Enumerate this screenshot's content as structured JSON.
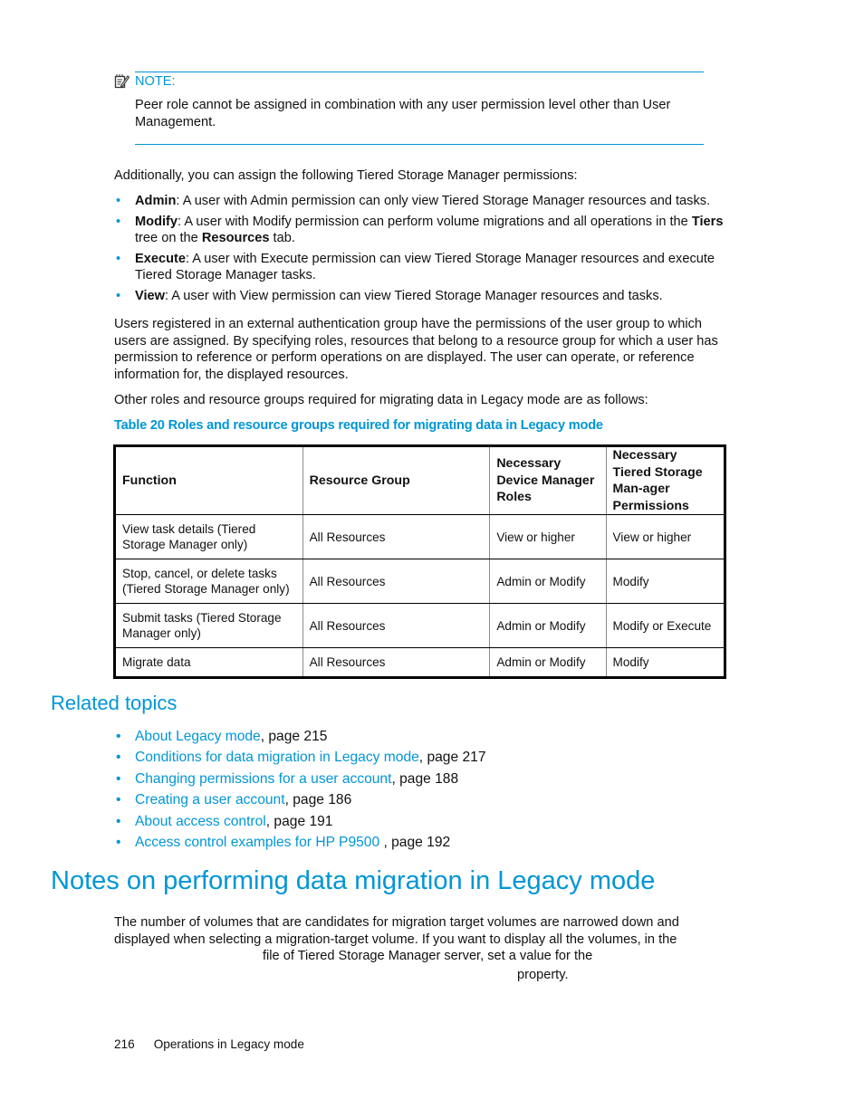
{
  "note": {
    "icon": "note-pencil-icon",
    "label": "NOTE:",
    "text": "Peer role cannot be assigned in combination with any user permission level other than User Management."
  },
  "intro": "Additionally, you can assign the following Tiered Storage Manager permissions:",
  "permissions": [
    {
      "term": "Admin",
      "parts": [
        ": A user with Admin permission can only view Tiered Storage Manager resources and tasks."
      ]
    },
    {
      "term": "Modify",
      "parts": [
        ": A user with Modify permission can perform volume migrations and all operations in the ",
        "Tiers",
        " tree on the ",
        "Resources",
        " tab."
      ]
    },
    {
      "term": "Execute",
      "parts": [
        ": A user with Execute permission can view Tiered Storage Manager resources and execute Tiered Storage Manager tasks."
      ]
    },
    {
      "term": "View",
      "parts": [
        ": A user with View permission can view Tiered Storage Manager resources and tasks."
      ]
    }
  ],
  "para_external": "Users registered in an external authentication group have the permissions of the user group to which users are assigned. By specifying roles, resources that belong to a resource group for which a user has permission to reference or perform operations on are displayed. The user can operate, or reference information for, the displayed resources.",
  "para_other": "Other roles and resource groups required for migrating data in Legacy mode are as follows:",
  "table": {
    "caption": "Table 20 Roles and resource groups required for migrating data in Legacy mode",
    "headers": [
      "Function",
      "Resource Group",
      "Necessary Device Manager Roles",
      "Necessary Tiered Storage Man-ager Permissions"
    ],
    "rows": [
      [
        "View task details (Tiered Storage Manager only)",
        "All Resources",
        "View or higher",
        "View or higher"
      ],
      [
        "Stop, cancel, or delete tasks (Tiered Storage Manager only)",
        "All Resources",
        "Admin or Modify",
        "Modify"
      ],
      [
        "Submit tasks (Tiered Storage Manager only)",
        "All Resources",
        "Admin or Modify",
        "Modify or Execute"
      ],
      [
        "Migrate data",
        "All Resources",
        "Admin or Modify",
        "Modify"
      ]
    ]
  },
  "related": {
    "heading": "Related topics",
    "items": [
      {
        "link": "About Legacy mode",
        "suffix": ", page 215"
      },
      {
        "link": "Conditions for data migration in Legacy mode",
        "suffix": ", page 217"
      },
      {
        "link": "Changing permissions for a user account",
        "suffix": ", page 188"
      },
      {
        "link": "Creating a user account",
        "suffix": ", page 186"
      },
      {
        "link": "About access control",
        "suffix": ", page 191"
      },
      {
        "link": "Access control examples for HP P9500 ",
        "suffix": ", page 192"
      }
    ]
  },
  "section": {
    "heading": "Notes on performing data migration in Legacy mode",
    "line1": "The number of volumes that are candidates for migration target volumes are narrowed down and",
    "line2": "displayed when selecting a migration-target volume. If you want to display all the volumes, in the",
    "line3": "file of Tiered Storage Manager server, set a value for the",
    "line4": "property."
  },
  "footer": {
    "page_number": "216",
    "chapter": "Operations in Legacy mode"
  },
  "colors": {
    "accent": "#0096d6",
    "text": "#111111"
  }
}
